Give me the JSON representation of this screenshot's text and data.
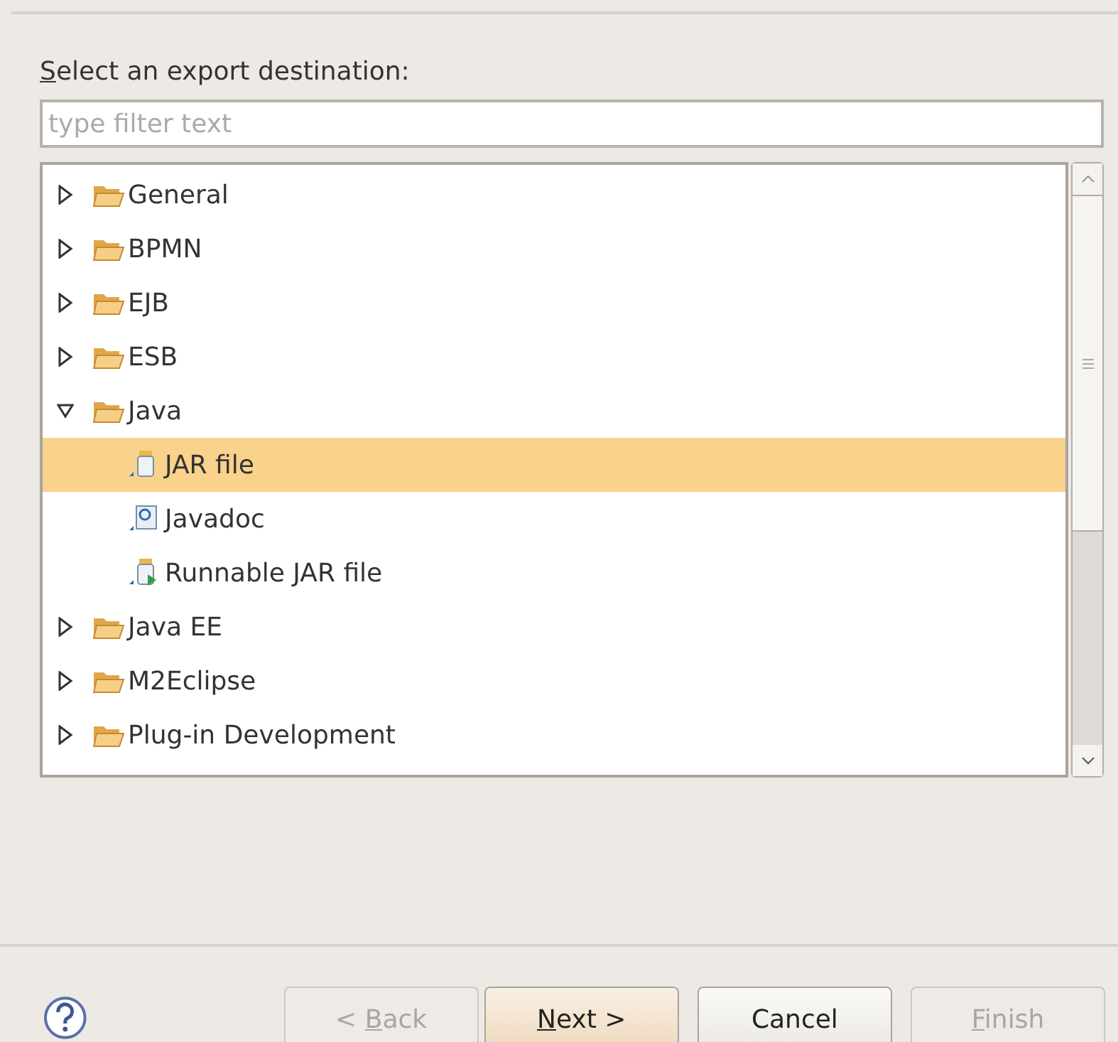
{
  "prompt": {
    "parts": [
      {
        "text": "S",
        "underlined": true
      },
      {
        "text": "elect an export destination:",
        "underlined": false
      }
    ]
  },
  "filter": {
    "placeholder": "type filter text"
  },
  "tree": [
    {
      "label": "General",
      "kind": "folder",
      "expanded": false,
      "selected": false
    },
    {
      "label": "BPMN",
      "kind": "folder",
      "expanded": false,
      "selected": false
    },
    {
      "label": "EJB",
      "kind": "folder",
      "expanded": false,
      "selected": false
    },
    {
      "label": "ESB",
      "kind": "folder",
      "expanded": false,
      "selected": false
    },
    {
      "label": "Java",
      "kind": "folder",
      "expanded": true,
      "selected": false,
      "children": [
        {
          "label": "JAR file",
          "kind": "jar",
          "selected": true
        },
        {
          "label": "Javadoc",
          "kind": "javadoc",
          "selected": false
        },
        {
          "label": "Runnable JAR file",
          "kind": "runnable-jar",
          "selected": false
        }
      ]
    },
    {
      "label": "Java EE",
      "kind": "folder",
      "expanded": false,
      "selected": false
    },
    {
      "label": "M2Eclipse",
      "kind": "folder",
      "expanded": false,
      "selected": false
    },
    {
      "label": "Plug-in Development",
      "kind": "folder",
      "expanded": false,
      "selected": false
    }
  ],
  "buttons": [
    {
      "parts": [
        {
          "text": "< ",
          "underlined": false
        },
        {
          "text": "B",
          "underlined": true
        },
        {
          "text": "ack",
          "underlined": false
        }
      ],
      "disabled": true,
      "default": false
    },
    {
      "parts": [
        {
          "text": "N",
          "underlined": true
        },
        {
          "text": "ext >",
          "underlined": false
        }
      ],
      "disabled": false,
      "default": true
    },
    {
      "parts": [
        {
          "text": "Cancel",
          "underlined": false
        }
      ],
      "disabled": false,
      "default": false
    },
    {
      "parts": [
        {
          "text": "F",
          "underlined": true
        },
        {
          "text": "inish",
          "underlined": false
        }
      ],
      "disabled": true,
      "default": false
    }
  ]
}
